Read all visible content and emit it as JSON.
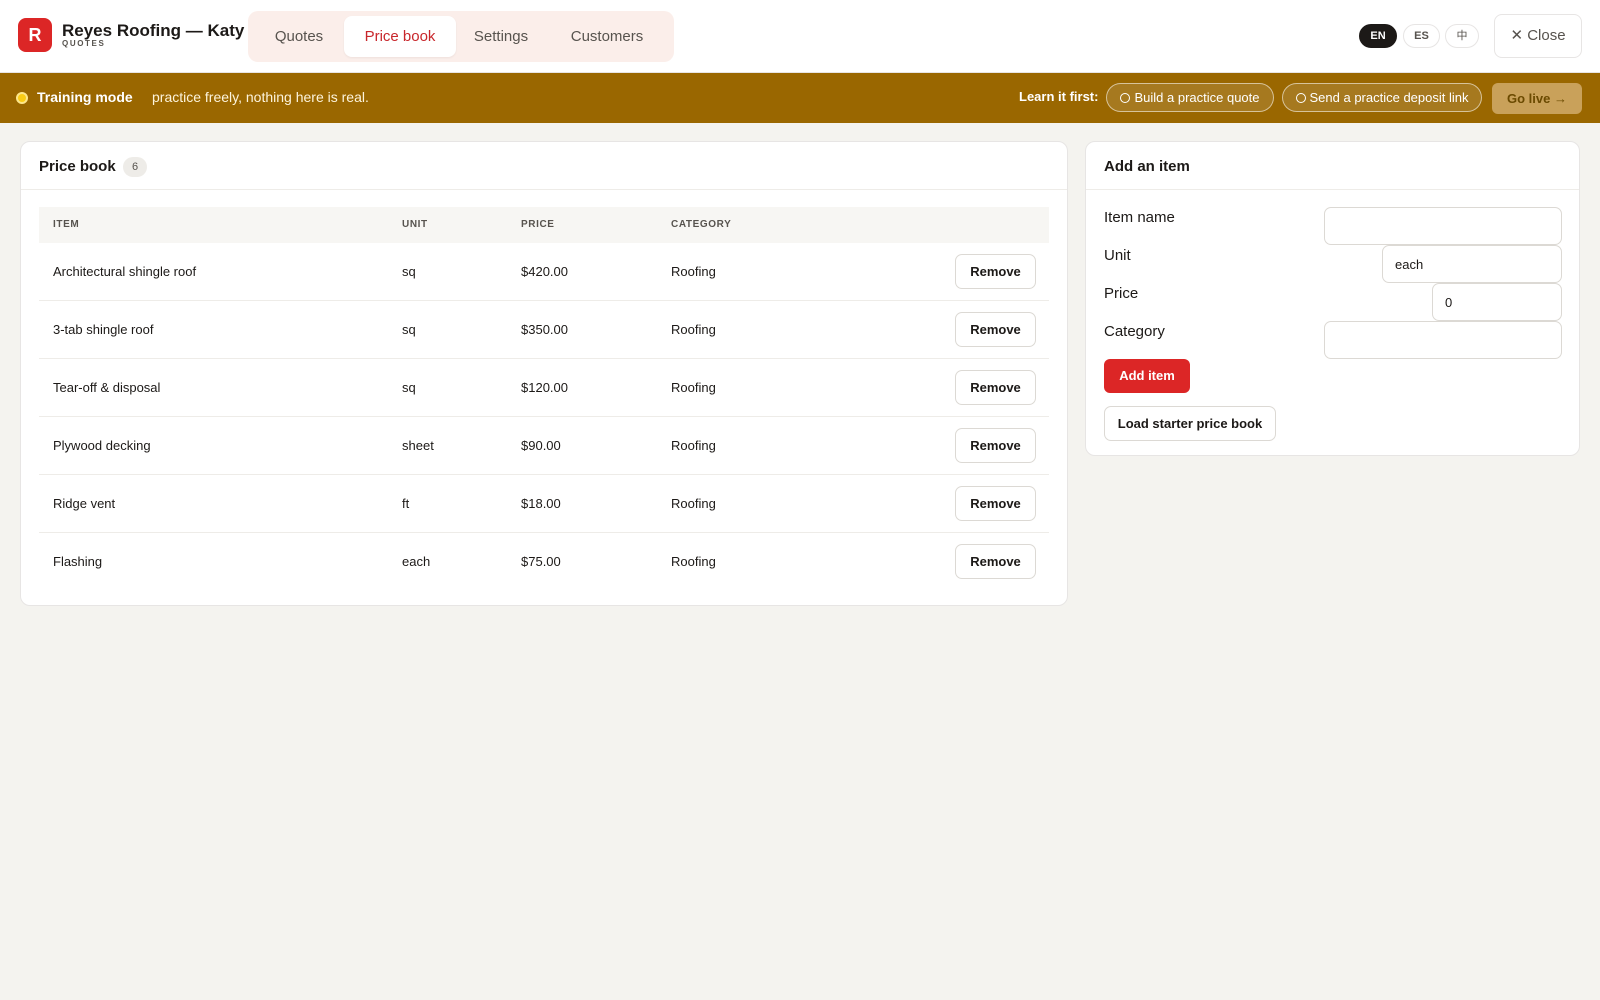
{
  "header": {
    "logo_letter": "R",
    "brand_title": "Reyes Roofing — Katy",
    "brand_subtitle": "QUOTES",
    "tabs": [
      {
        "label": "Quotes",
        "active": false
      },
      {
        "label": "Price book",
        "active": true
      },
      {
        "label": "Settings",
        "active": false
      },
      {
        "label": "Customers",
        "active": false
      }
    ],
    "languages": [
      {
        "label": "EN",
        "active": true
      },
      {
        "label": "ES",
        "active": false
      },
      {
        "label": "中",
        "active": false
      }
    ],
    "close_label": "✕ Close"
  },
  "banner": {
    "title": "Training mode",
    "text": "practice freely, nothing here is real.",
    "learn_label": "Learn it first:",
    "tasks": [
      {
        "label": "Build a practice quote",
        "done": false
      },
      {
        "label": "Send a practice deposit link",
        "done": false
      }
    ],
    "go_live_label": "Go live →"
  },
  "price_book": {
    "title": "Price book",
    "count": "6",
    "columns": [
      "ITEM",
      "UNIT",
      "PRICE",
      "CATEGORY"
    ],
    "remove_label": "Remove",
    "rows": [
      {
        "item": "Architectural shingle roof",
        "unit": "sq",
        "price": "$420.00",
        "category": "Roofing"
      },
      {
        "item": "3-tab shingle roof",
        "unit": "sq",
        "price": "$350.00",
        "category": "Roofing"
      },
      {
        "item": "Tear-off & disposal",
        "unit": "sq",
        "price": "$120.00",
        "category": "Roofing"
      },
      {
        "item": "Plywood decking",
        "unit": "sheet",
        "price": "$90.00",
        "category": "Roofing"
      },
      {
        "item": "Ridge vent",
        "unit": "ft",
        "price": "$18.00",
        "category": "Roofing"
      },
      {
        "item": "Flashing",
        "unit": "each",
        "price": "$75.00",
        "category": "Roofing"
      }
    ]
  },
  "add_item": {
    "title": "Add an item",
    "fields": {
      "name": {
        "label": "Item name",
        "value": ""
      },
      "unit": {
        "label": "Unit",
        "value": "each"
      },
      "price": {
        "label": "Price",
        "value": "0"
      },
      "category": {
        "label": "Category",
        "value": ""
      }
    },
    "add_label": "Add item",
    "starter_label": "Load starter price book"
  },
  "colors": {
    "brand_red": "#dc2626",
    "active_tab_text": "#c8262b",
    "banner_bg": "#9a6700",
    "go_live_bg": "#c9a15a",
    "page_bg": "#f4f3ef"
  }
}
